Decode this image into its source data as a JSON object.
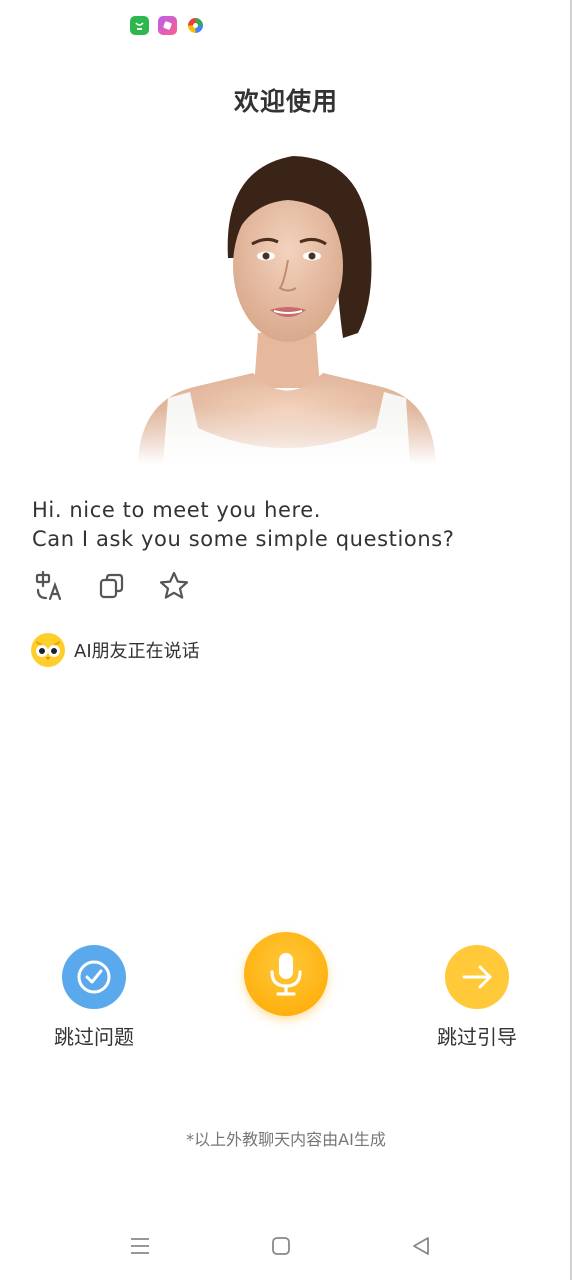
{
  "status_bar": {
    "icons": [
      "green-bag-app-icon",
      "pink-app-icon",
      "colorful-circle-app-icon"
    ]
  },
  "header": {
    "title": "欢迎使用"
  },
  "avatar": {
    "icon": "ai-teacher-avatar"
  },
  "message": {
    "line1": "Hi. nice to meet you here.",
    "line2": "Can I ask you some simple questions?"
  },
  "message_actions": [
    "translate-icon",
    "copy-icon",
    "star-icon"
  ],
  "speaker": {
    "label": "AI朋友正在说话",
    "icon": "owl-icon"
  },
  "controls": {
    "skip_question": {
      "label": "跳过问题",
      "color": "#5aa9ec"
    },
    "mic": {
      "color": "#ffb300"
    },
    "skip_guide": {
      "label": "跳过引导",
      "color": "#ffc93a"
    }
  },
  "footnote": "*以上外教聊天内容由AI生成",
  "nav_bar": [
    "menu-icon",
    "home-icon",
    "back-icon"
  ]
}
